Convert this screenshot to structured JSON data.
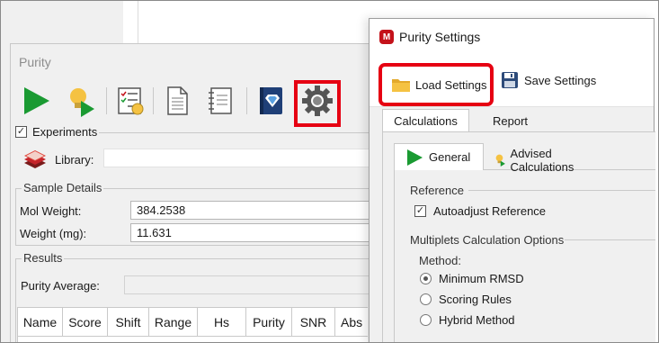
{
  "purity_window": {
    "title": "Purity",
    "toolbar": {
      "icons": [
        "run-icon",
        "advise-run-icon",
        "checklist-icon",
        "document-icon",
        "notebook-icon",
        "library-book-icon",
        "settings-gear-icon"
      ],
      "highlight_color": "#e60012"
    },
    "experiments_label": "Experiments",
    "library_label": "Library:",
    "sample_details": {
      "title": "Sample Details",
      "mol_weight_label": "Mol Weight:",
      "mol_weight_value": "384.2538",
      "weight_label": "Weight (mg):",
      "weight_value": "11.631"
    },
    "results": {
      "title": "Results",
      "purity_average_label": "Purity Average:",
      "columns": [
        "Name",
        "Score",
        "Shift",
        "Range",
        "Hs",
        "Purity",
        "SNR",
        "Abs"
      ]
    }
  },
  "settings_dialog": {
    "title": "Purity Settings",
    "load_settings_label": "Load Settings",
    "save_settings_label": "Save Settings",
    "tabs": [
      "Calculations",
      "Report"
    ],
    "subtabs": [
      "General",
      "Advised Calculations"
    ],
    "reference": {
      "title": "Reference",
      "autoadjust_label": "Autoadjust Reference",
      "autoadjust_checked": true
    },
    "multiplets": {
      "title": "Multiplets Calculation Options",
      "method_label": "Method:",
      "options": [
        "Minimum RMSD",
        "Scoring Rules",
        "Hybrid Method"
      ],
      "selected": "Minimum RMSD"
    }
  },
  "colors": {
    "highlight": "#e60012",
    "run_green": "#1a9a32",
    "app_red": "#c4121a"
  }
}
